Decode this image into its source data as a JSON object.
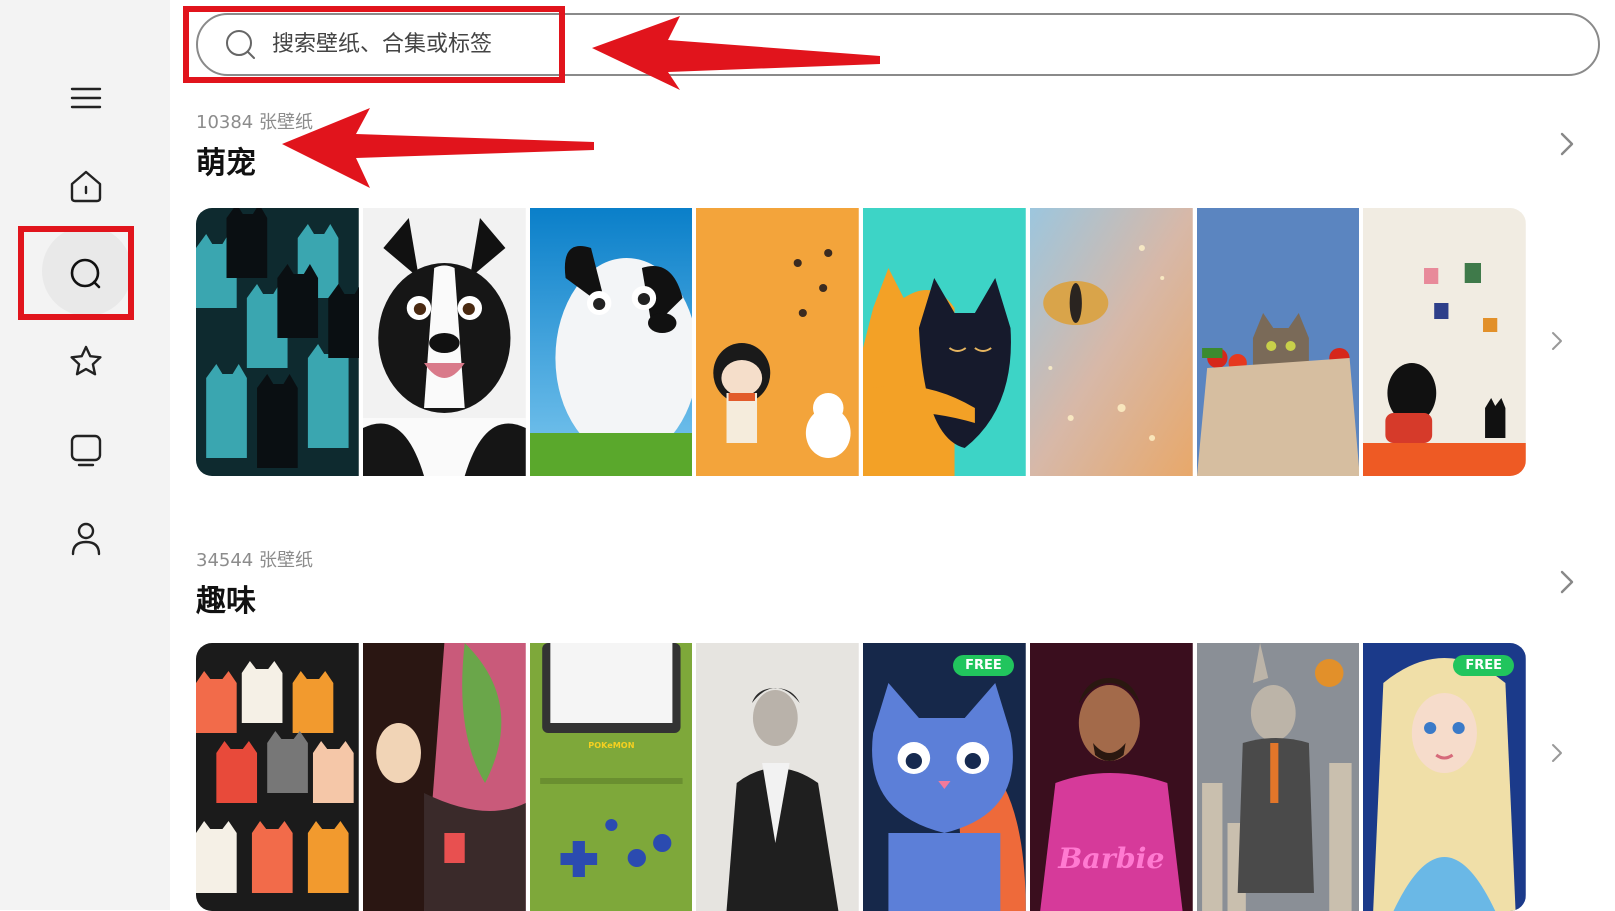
{
  "sidebar": {
    "icons": [
      "menu-icon",
      "home-icon",
      "search-icon",
      "star-icon",
      "tablet-icon",
      "person-icon"
    ],
    "active": "search"
  },
  "search": {
    "placeholder": "搜索壁纸、合集或标签",
    "value": ""
  },
  "sections": [
    {
      "count_label": "10384  张壁纸",
      "title": "萌宠",
      "thumbnails": [
        "black-teal-cats",
        "border-collie",
        "cartoon-dog-sky",
        "girl-with-cat-orange",
        "black-cat-hug",
        "glowing-cat-eye",
        "cat-in-grocery-bag",
        "girl-with-black-cat"
      ]
    },
    {
      "count_label": "34544  张壁纸",
      "title": "趣味",
      "thumbnails": [
        "colorful-cats-pattern",
        "anime-demon-slayer",
        "gameboy-advance-pokemon",
        "man-portrait-bw",
        "blue-cartoon-cat",
        "man-pink-barbie",
        "rabbit-in-coat-city",
        "elsa-portrait"
      ],
      "badges": [
        "",
        "",
        "",
        "",
        "FREE",
        "",
        "",
        "FREE"
      ]
    }
  ],
  "colors": {
    "accent": "#e1141c",
    "badge_green": "#21c55d",
    "sidebar_bg": "#f3f3f3"
  }
}
